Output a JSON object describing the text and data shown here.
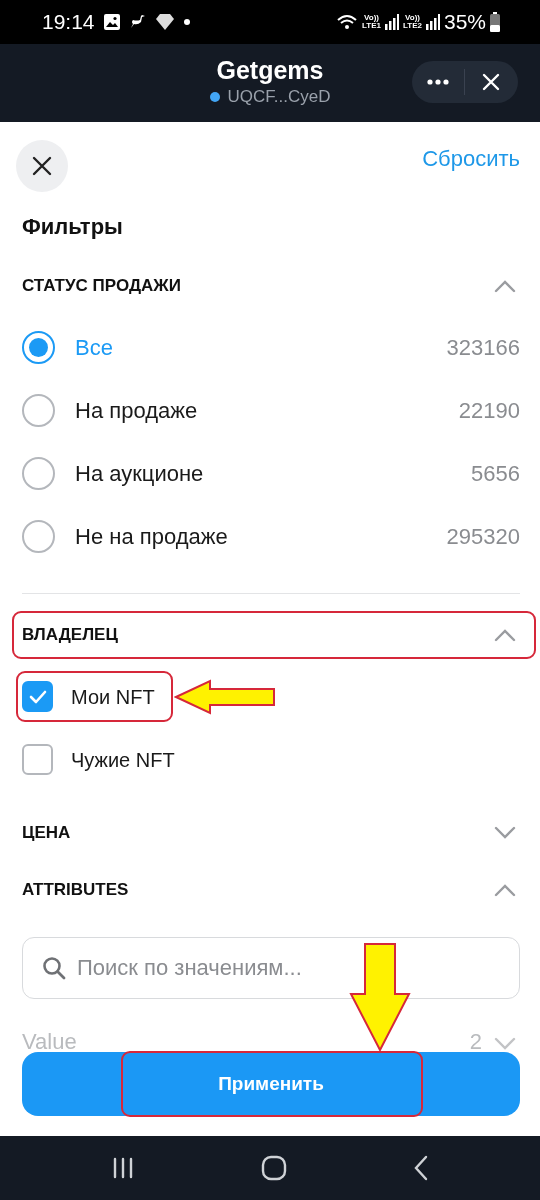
{
  "status_bar": {
    "time": "19:14",
    "sims": [
      {
        "top": "Vo))",
        "bottom": "LTE1"
      },
      {
        "top": "Vo))",
        "bottom": "LTE2"
      }
    ],
    "battery": "35%"
  },
  "header": {
    "title": "Getgems",
    "wallet": "UQCF...CyeD"
  },
  "toolbar": {
    "reset": "Сбросить"
  },
  "heading": "Фильтры",
  "sale_status": {
    "title": "СТАТУС ПРОДАЖИ",
    "expanded": true,
    "options": [
      {
        "label": "Все",
        "count": "323166",
        "selected": true
      },
      {
        "label": "На продаже",
        "count": "22190",
        "selected": false
      },
      {
        "label": "На аукционе",
        "count": "5656",
        "selected": false
      },
      {
        "label": "Не на продаже",
        "count": "295320",
        "selected": false
      }
    ]
  },
  "owner": {
    "title": "ВЛАДЕЛЕЦ",
    "expanded": true,
    "highlighted": true,
    "options": [
      {
        "label": "Мои NFT",
        "checked": true,
        "highlighted": true
      },
      {
        "label": "Чужие NFT",
        "checked": false,
        "highlighted": false
      }
    ]
  },
  "price": {
    "title": "ЦЕНА",
    "expanded": false
  },
  "attributes": {
    "title": "ATTRIBUTES",
    "expanded": true,
    "search": {
      "placeholder": "Поиск по значениям..."
    },
    "rows": [
      {
        "label": "Value",
        "count": "2",
        "expanded": false
      }
    ]
  },
  "apply_button": {
    "label": "Применить",
    "highlighted": true
  },
  "annotations": [
    {
      "kind": "left-arrow"
    },
    {
      "kind": "down-arrow"
    }
  ]
}
